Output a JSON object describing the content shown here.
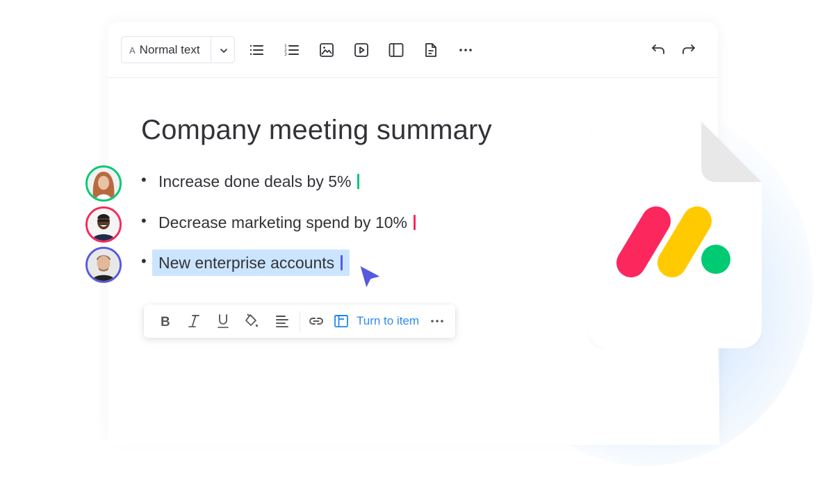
{
  "toolbar": {
    "text_style": {
      "icon": "font-a-icon",
      "glyph": "A",
      "selected": "Normal text"
    },
    "buttons": [
      {
        "name": "bulleted-list",
        "icon": "bulleted-list-icon"
      },
      {
        "name": "numbered-list",
        "icon": "numbered-list-icon"
      },
      {
        "name": "insert-image",
        "icon": "image-icon"
      },
      {
        "name": "insert-video",
        "icon": "video-play-icon"
      },
      {
        "name": "layout",
        "icon": "layout-columns-icon"
      },
      {
        "name": "insert-document",
        "icon": "document-icon"
      },
      {
        "name": "more",
        "icon": "more-horizontal-icon"
      }
    ],
    "undo": {
      "icon": "undo-icon"
    },
    "redo": {
      "icon": "redo-icon"
    }
  },
  "document": {
    "title": "Company meeting summary",
    "bullet_glyph": "•",
    "items": [
      {
        "text": "Increase done deals by 5%",
        "author_color": "#00c875",
        "selected": false
      },
      {
        "text": "Decrease marketing spend by 10%",
        "author_color": "#fb275d",
        "selected": false
      },
      {
        "text": "New enterprise accounts",
        "author_color": "#5559df",
        "selected": true
      }
    ]
  },
  "format_bar": {
    "buttons": [
      {
        "name": "bold",
        "icon": "bold-icon"
      },
      {
        "name": "italic",
        "icon": "italic-icon"
      },
      {
        "name": "underline",
        "icon": "underline-icon"
      },
      {
        "name": "text-color",
        "icon": "paint-bucket-icon"
      },
      {
        "name": "align",
        "icon": "align-left-icon"
      },
      {
        "name": "link",
        "icon": "link-icon"
      }
    ],
    "turn_to_item": {
      "icon": "board-item-icon",
      "label": "Turn to item"
    },
    "more": {
      "icon": "more-horizontal-icon"
    }
  },
  "colors": {
    "accent": "#0073ea",
    "selection": "#cce5ff",
    "cursor": "#5559df",
    "logo_red": "#fb275d",
    "logo_yellow": "#ffcb00",
    "logo_green": "#00ca72"
  },
  "file_badge": {
    "icon": "monday-logo-file-icon"
  }
}
